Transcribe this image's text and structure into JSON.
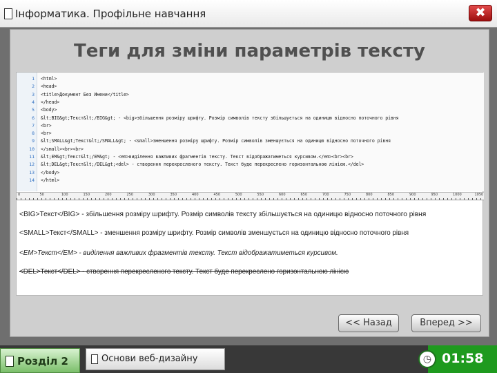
{
  "window": {
    "title": "Інформатика. Профільне навчання",
    "close_label": "✖",
    "icon": "document-icon"
  },
  "slide": {
    "title": "Теги для зміни параметрів тексту"
  },
  "code": {
    "line_numbers": [
      "1",
      "2",
      "3",
      "4",
      "5",
      "6",
      "7",
      "8",
      "9",
      "10",
      "11",
      "12",
      "13",
      "14"
    ],
    "lines": [
      "<html>",
      "<head>",
      "<title>Документ Без Имени</title>",
      "</head>",
      "<body>",
      "&lt;BIG&gt;Текст&lt;/BIG&gt; - <big>збільшення розміру шрифту. Розмір символів тексту збільшується на одиницю відносно поточного рівня",
      "<br>",
      "<br>",
      "&lt;SMALL&gt;Текст&lt;/SMALL&gt; - <small>зменшення розміру шрифту. Розмір символів зменшується на одиницю відносно поточного рівня",
      "</small><br><br>",
      "&lt;EM&gt;Текст&lt;/EM&gt;  - <em>виділення важливих фрагментів тексту. Текст відображатиметься курсивом.</em><br><br>",
      "&lt;DEL&gt;Текст&lt;/DEL&gt;<del> - створення перекресленого тексту. Текст буде перекреслено горизонтальною лінією.</del>",
      "</body>",
      "</html>"
    ]
  },
  "ruler": {
    "labels": [
      "0",
      "50",
      "100",
      "150",
      "200",
      "250",
      "300",
      "350",
      "400",
      "450",
      "500",
      "550",
      "600",
      "650",
      "700",
      "750",
      "800",
      "850",
      "900",
      "950",
      "1000",
      "1050"
    ]
  },
  "preview": {
    "big": "<BIG>Текст</BIG> - збільшення розміру шрифту. Розмір символів тексту збільшується на одиницю відносно поточного рівня",
    "small": "<SMALL>Текст</SMALL> - зменшення розміру шрифту. Розмір символів зменшується на одиницю відносно поточного рівня",
    "em": "<EM>Текст</EM> - виділення важливих фрагментів тексту. Текст відображатиметься курсивом.",
    "del": "<DEL>Текст</DEL> - створення перекресленого тексту. Текст буде перекреслено горизонтальною лінією"
  },
  "nav": {
    "back_label": "<< Назад",
    "forward_label": "Вперед >>"
  },
  "footer": {
    "section_label": "Розділ 2",
    "topic_label": "Основи веб-дизайну",
    "timer": "01:58",
    "timer_icon": "clock-icon"
  },
  "colors": {
    "close_red": "#c11b1b",
    "section_green": "#7bbf6a",
    "timer_green": "#1e9a1e",
    "line_number_blue": "#2f6fc2"
  }
}
